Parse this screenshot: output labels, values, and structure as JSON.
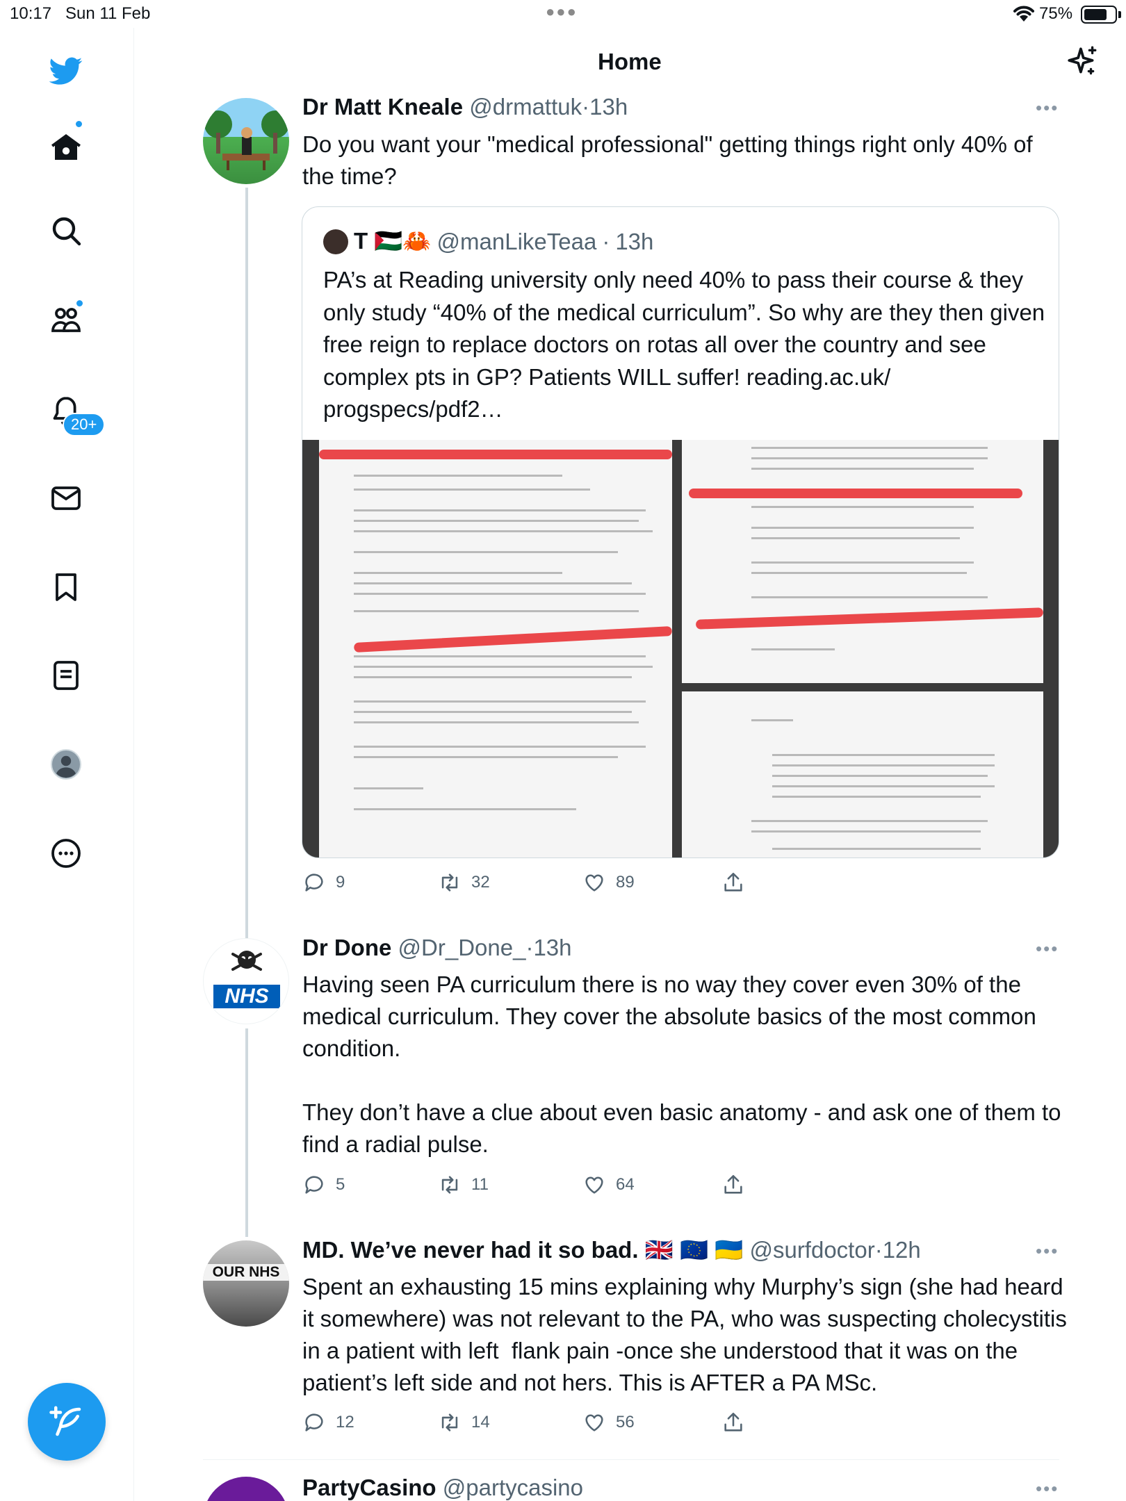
{
  "status_bar": {
    "time": "10:17",
    "date": "Sun 11 Feb",
    "battery": "75%",
    "battery_level": 0.75
  },
  "header": {
    "title": "Home"
  },
  "sidebar": {
    "notifications_badge": "20+"
  },
  "tweets": [
    {
      "name": "Dr Matt Kneale",
      "handle": "@drmattuk",
      "sep": "·",
      "time": "13h",
      "text": "Do you want your \"medical professional\" getting things right only 40% of the time?",
      "quote": {
        "name": "T 🇵🇸🦀",
        "handle": "@manLikeTeaa",
        "sep": "·",
        "time": "13h",
        "text": "PA’s at Reading university only need 40% to pass their course & they only study “40% of the medical curriculum”. So why are they then given free reign to replace doctors on rotas all over the country and see complex pts in GP? Patients WILL suffer! reading.ac.uk/ progspecs/pdf2…"
      },
      "stats": {
        "replies": "9",
        "retweets": "32",
        "likes": "89"
      }
    },
    {
      "name": "Dr Done",
      "handle": "@Dr_Done_",
      "sep": "·",
      "time": "13h",
      "avatar_text": "NHS",
      "text": "Having seen PA curriculum there is no way they cover even 30% of the medical curriculum. They cover the absolute basics of the most common condition.\n\nThey don’t have a clue about even basic anatomy - and ask one of them to find a radial pulse.",
      "stats": {
        "replies": "5",
        "retweets": "11",
        "likes": "64"
      }
    },
    {
      "name": "MD. We’ve never had it so bad.",
      "flags": "🇬🇧 🇪🇺 🇺🇦",
      "handle": "@surfdoctor",
      "sep": "·",
      "time": "12h",
      "avatar_text": "OUR NHS",
      "text": "Spent an exhausting 15 mins explaining why Murphy’s sign (she had heard it somewhere) was not relevant to the PA, who was suspecting cholecystitis in a patient with left  flank pain -once she understood that it was on the patient’s left side and not hers. This is AFTER a PA MSc.",
      "stats": {
        "replies": "12",
        "retweets": "14",
        "likes": "56"
      }
    },
    {
      "name": "PartyCasino",
      "handle": "@partycasino"
    }
  ],
  "colors": {
    "accent": "#1d9bf0",
    "secondary_text": "#536471",
    "border": "#cfd9de"
  }
}
